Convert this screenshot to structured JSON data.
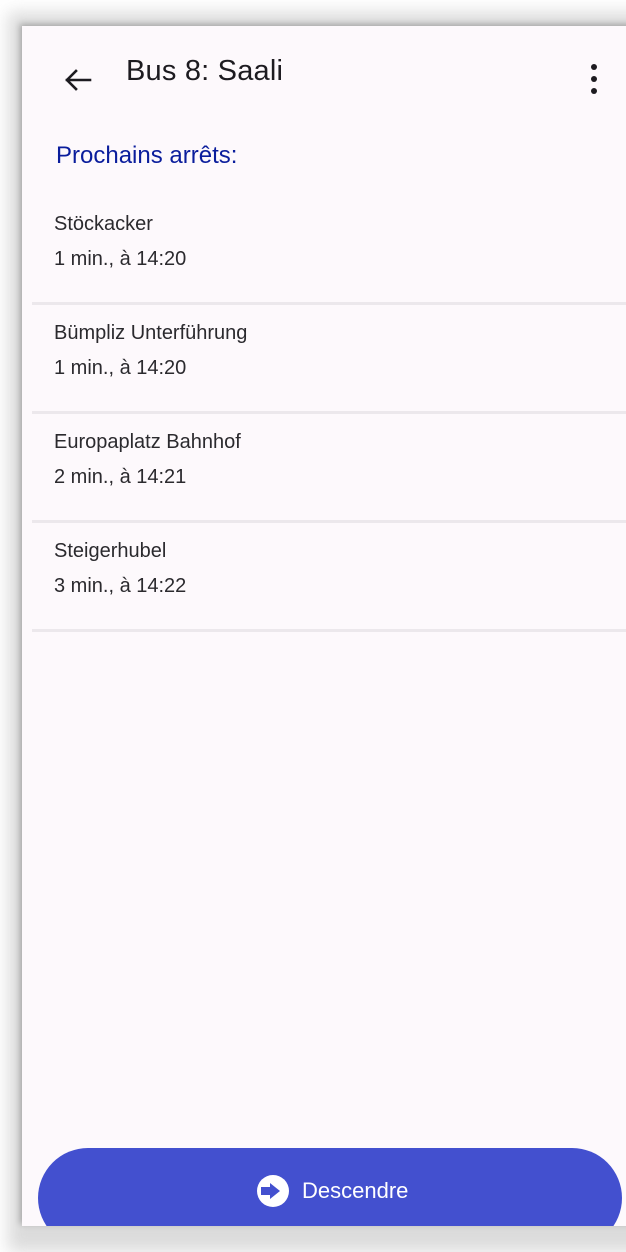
{
  "app_bar": {
    "title": "Bus 8: Saali",
    "back_icon": "arrow-back-icon",
    "menu_icon": "more-vert-icon"
  },
  "section": {
    "heading": "Prochains arrêts:"
  },
  "stops": [
    {
      "name": "Stöckacker",
      "time": "1 min., à 14:20"
    },
    {
      "name": "Bümpliz Unterführung",
      "time": "1 min., à 14:20"
    },
    {
      "name": "Europaplatz Bahnhof",
      "time": "2 min., à 14:21"
    },
    {
      "name": "Steigerhubel",
      "time": "3 min., à 14:22"
    }
  ],
  "action": {
    "label": "Descendre",
    "icon": "exit-stop-icon"
  },
  "colors": {
    "accent": "#4350cf",
    "heading": "#0a1d9c",
    "background": "#fdf9fc",
    "divider": "#ece8ec"
  }
}
